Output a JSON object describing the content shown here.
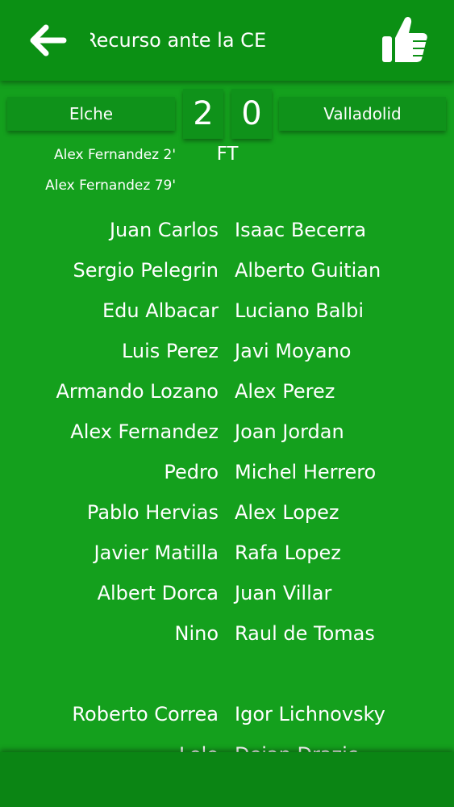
{
  "header": {
    "title": "Recurso ante la CE",
    "back_icon": "arrow-left-icon",
    "like_icon": "thumbs-up-icon"
  },
  "match": {
    "home_team": "Elche",
    "away_team": "Valladolid",
    "home_score": "2",
    "away_score": "0",
    "status": "FT",
    "home_scorers": [
      "Alex Fernandez 2'",
      "Alex Fernandez 79'"
    ]
  },
  "lineups": {
    "starters": [
      {
        "home": "Juan Carlos",
        "away": "Isaac Becerra"
      },
      {
        "home": "Sergio Pelegrin",
        "away": "Alberto Guitian"
      },
      {
        "home": "Edu Albacar",
        "away": "Luciano Balbi"
      },
      {
        "home": "Luis Perez",
        "away": "Javi Moyano"
      },
      {
        "home": "Armando Lozano",
        "away": "Alex Perez"
      },
      {
        "home": "Alex Fernandez",
        "away": "Joan Jordan"
      },
      {
        "home": "Pedro",
        "away": "Michel Herrero"
      },
      {
        "home": "Pablo Hervias",
        "away": "Alex Lopez"
      },
      {
        "home": "Javier Matilla",
        "away": "Rafa Lopez"
      },
      {
        "home": "Albert Dorca",
        "away": "Juan Villar"
      },
      {
        "home": "Nino",
        "away": "Raul de Tomas"
      }
    ],
    "subs": [
      {
        "home": "Roberto Correa",
        "away": "Igor Lichnovsky"
      },
      {
        "home": "Lolo",
        "away": "Dejan Drazic"
      }
    ]
  },
  "colors": {
    "background": "#14a01d",
    "bar": "#0b9014",
    "box": "#0f921a",
    "text": "#ffffff"
  }
}
